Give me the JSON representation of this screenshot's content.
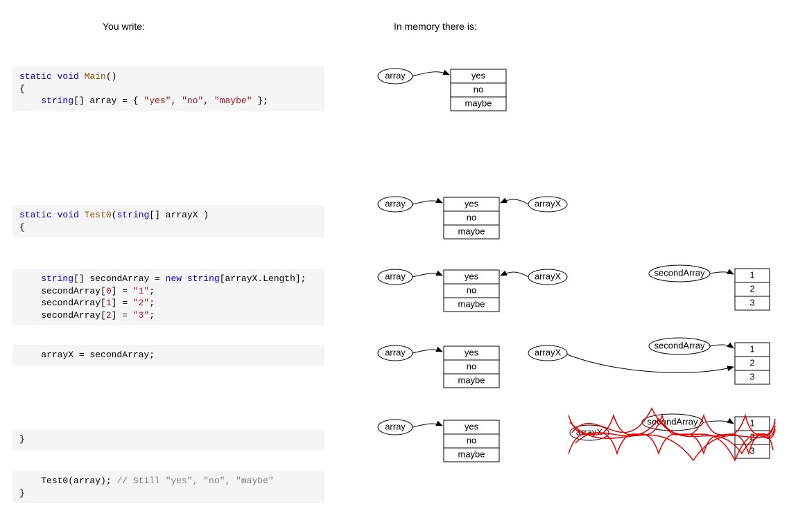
{
  "headings": {
    "left": "You write:",
    "right": "In memory there is:"
  },
  "code": {
    "block1_l1_a": "static",
    "block1_l1_b": "void",
    "block1_l1_c": "Main",
    "block1_l1_d": "()",
    "block1_l2": "{",
    "block1_l3_a": "string",
    "block1_l3_b": "[] array = { ",
    "block1_l3_s1": "\"yes\"",
    "block1_l3_c": ", ",
    "block1_l3_s2": "\"no\"",
    "block1_l3_d": ", ",
    "block1_l3_s3": "\"maybe\"",
    "block1_l3_e": " };",
    "block2_l1_a": "static",
    "block2_l1_b": "void",
    "block2_l1_c": "Test0",
    "block2_l1_d": "(",
    "block2_l1_e": "string",
    "block2_l1_f": "[] arrayX )",
    "block2_l2": "{",
    "block3_l1_a": "string",
    "block3_l1_b": "[] secondArray = ",
    "block3_l1_c": "new",
    "block3_l1_d": " ",
    "block3_l1_e": "string",
    "block3_l1_f": "[arrayX.Length];",
    "block3_l2_a": "secondArray[",
    "block3_l2_n": "0",
    "block3_l2_b": "] = ",
    "block3_l2_s": "\"1\"",
    "block3_l2_c": ";",
    "block3_l3_a": "secondArray[",
    "block3_l3_n": "1",
    "block3_l3_b": "] = ",
    "block3_l3_s": "\"2\"",
    "block3_l3_c": ";",
    "block3_l4_a": "secondArray[",
    "block3_l4_n": "2",
    "block3_l4_b": "] = ",
    "block3_l4_s": "\"3\"",
    "block3_l4_c": ";",
    "block4_l1": "arrayX = secondArray;",
    "block5_l1": "}",
    "block6_l1_a": "Test0(array); ",
    "block6_l1_b": "// Still \"yes\", \"no\", \"maybe\"",
    "block6_l2": "}"
  },
  "diagram": {
    "labels": {
      "array": "array",
      "arrayX": "arrayX",
      "secondArray": "secondArray"
    },
    "yesnomaybe": [
      "yes",
      "no",
      "maybe"
    ],
    "one23": [
      "1",
      "2",
      "3"
    ]
  }
}
